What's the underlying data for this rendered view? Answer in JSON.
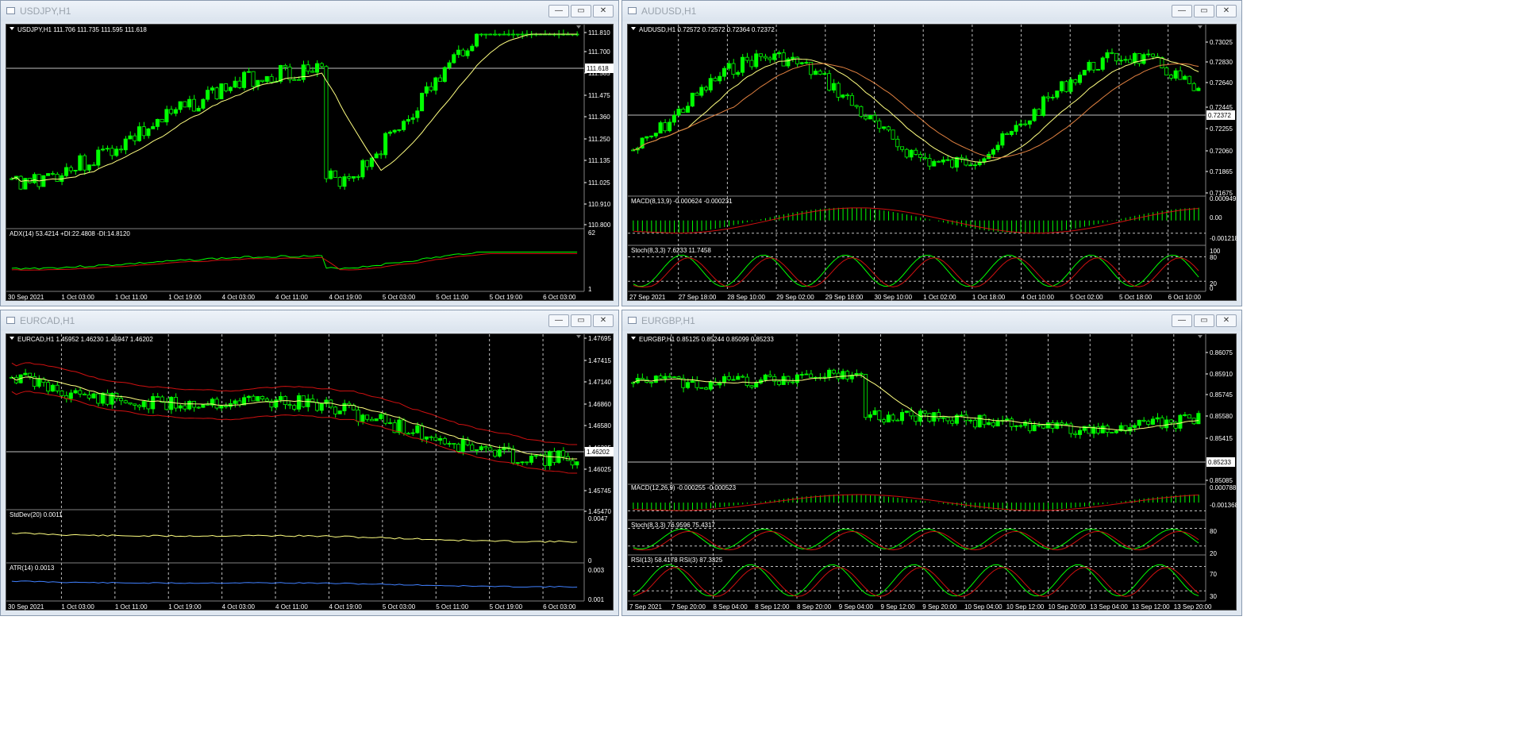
{
  "windows": [
    {
      "title": "USDJPY,H1",
      "header": "USDJPY,H1  111.706 111.735 111.595 111.618",
      "price_label": "111.618",
      "price_levels": [
        "111.810",
        "111.700",
        "111.585",
        "111.475",
        "111.360",
        "111.250",
        "111.135",
        "111.025",
        "110.910",
        "110.800"
      ],
      "indicators": [
        {
          "label": "ADX(14) 53.4214 +DI:22.4808 -DI:14.8120",
          "levels": [
            "62",
            "1"
          ]
        }
      ],
      "time_labels": [
        "30 Sep 2021",
        "1 Oct 03:00",
        "1 Oct 11:00",
        "1 Oct 19:00",
        "4 Oct 03:00",
        "4 Oct 11:00",
        "4 Oct 19:00",
        "5 Oct 03:00",
        "5 Oct 11:00",
        "5 Oct 19:00",
        "6 Oct 03:00"
      ]
    },
    {
      "title": "AUDUSD,H1",
      "header": "AUDUSD,H1  0.72572 0.72572 0.72364 0.72372",
      "price_label": "0.72372",
      "price_levels": [
        "0.73025",
        "0.72830",
        "0.72640",
        "0.72445",
        "0.72255",
        "0.72060",
        "0.71865",
        "0.71675"
      ],
      "indicators": [
        {
          "label": "MACD(8,13,9) -0.000624 -0.000231",
          "levels": [
            "0.000949",
            "0.00",
            "-0.001218"
          ]
        },
        {
          "label": "Stoch(8,3,3) 7.6233 11.7458",
          "levels": [
            "100",
            "80",
            "20",
            "0"
          ]
        }
      ],
      "time_labels": [
        "27 Sep 2021",
        "27 Sep 18:00",
        "28 Sep 10:00",
        "29 Sep 02:00",
        "29 Sep 18:00",
        "30 Sep 10:00",
        "1 Oct 02:00",
        "1 Oct 18:00",
        "4 Oct 10:00",
        "5 Oct 02:00",
        "5 Oct 18:00",
        "6 Oct 10:00"
      ]
    },
    {
      "title": "EURCAD,H1",
      "header": "EURCAD,H1  1.45952 1.46230 1.45947 1.46202",
      "price_label": "1.46202",
      "price_levels": [
        "1.47695",
        "1.47415",
        "1.47140",
        "1.46860",
        "1.46580",
        "1.46305",
        "1.46025",
        "1.45745",
        "1.45470"
      ],
      "indicators": [
        {
          "label": "StdDev(20) 0.0011",
          "levels": [
            "0.0047",
            "0"
          ]
        },
        {
          "label": "ATR(14) 0.0013",
          "levels": [
            "0.003",
            "0.001"
          ]
        }
      ],
      "time_labels": [
        "30 Sep 2021",
        "1 Oct 03:00",
        "1 Oct 11:00",
        "1 Oct 19:00",
        "4 Oct 03:00",
        "4 Oct 11:00",
        "4 Oct 19:00",
        "5 Oct 03:00",
        "5 Oct 11:00",
        "5 Oct 19:00",
        "6 Oct 03:00"
      ]
    },
    {
      "title": "EURGBP,H1",
      "header": "EURGBP,H1  0.85125 0.85244 0.85099 0.85233",
      "price_label": "0.85233",
      "price_levels": [
        "0.86075",
        "0.85910",
        "0.85745",
        "0.85580",
        "0.85415",
        "0.85085"
      ],
      "indicators": [
        {
          "label": "MACD(12,26,9) -0.000255 -0.000523",
          "levels": [
            "0.000788",
            "-0.001368"
          ]
        },
        {
          "label": "Stoch(8,3,3) 76.9596 75.4317",
          "levels": [
            "80",
            "20"
          ]
        },
        {
          "label": "RSI(13) 58.4178  RSI(3) 87.3325",
          "levels": [
            "70",
            "30"
          ]
        }
      ],
      "time_labels": [
        "7 Sep 2021",
        "7 Sep 20:00",
        "8 Sep 04:00",
        "8 Sep 12:00",
        "8 Sep 20:00",
        "9 Sep 04:00",
        "9 Sep 12:00",
        "9 Sep 20:00",
        "10 Sep 04:00",
        "10 Sep 12:00",
        "10 Sep 20:00",
        "13 Sep 04:00",
        "13 Sep 12:00",
        "13 Sep 20:00"
      ]
    }
  ],
  "controls": {
    "minimize": "—",
    "restore": "▭",
    "close": "✕"
  },
  "colors": {
    "candle": "#00ff00",
    "ma": "#ffff80",
    "red": "#d01010",
    "blue": "#4080ff",
    "grid": "#c0c0c0",
    "text": "#ffffff"
  }
}
